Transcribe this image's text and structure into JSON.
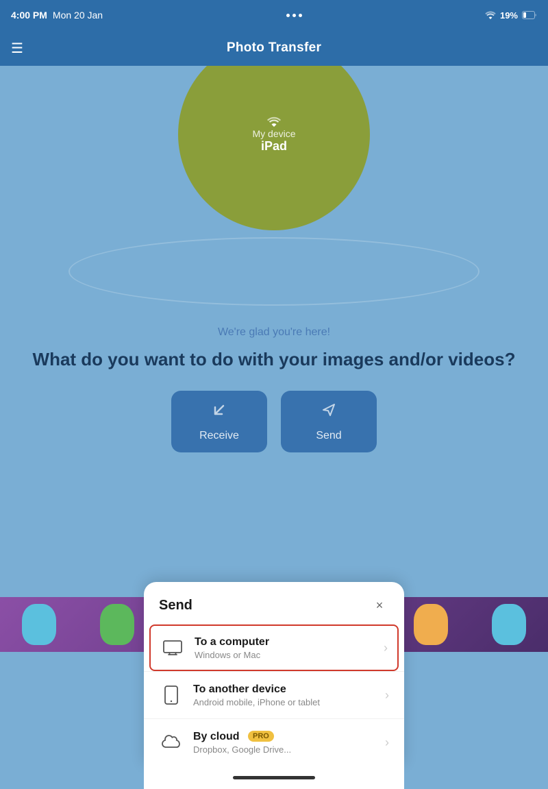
{
  "statusBar": {
    "time": "4:00 PM",
    "date": "Mon 20 Jan",
    "battery": "19%"
  },
  "header": {
    "title": "Photo Transfer",
    "menuIcon": "☰"
  },
  "device": {
    "label": "My device",
    "name": "iPad"
  },
  "welcome": {
    "subtitle": "We're glad you're here!",
    "question": "What do you want to do with your images and/or videos?"
  },
  "buttons": {
    "receive": {
      "label": "Receive",
      "icon": "↙"
    },
    "send": {
      "label": "Send",
      "icon": "➤"
    }
  },
  "modal": {
    "title": "Send",
    "closeIcon": "×",
    "items": [
      {
        "id": "to-computer",
        "title": "To a computer",
        "subtitle": "Windows or Mac",
        "highlighted": true,
        "pro": false
      },
      {
        "id": "to-device",
        "title": "To another device",
        "subtitle": "Android mobile, iPhone or tablet",
        "highlighted": false,
        "pro": false
      },
      {
        "id": "by-cloud",
        "title": "By cloud",
        "subtitle": "Dropbox, Google Drive...",
        "highlighted": false,
        "pro": true
      }
    ]
  }
}
